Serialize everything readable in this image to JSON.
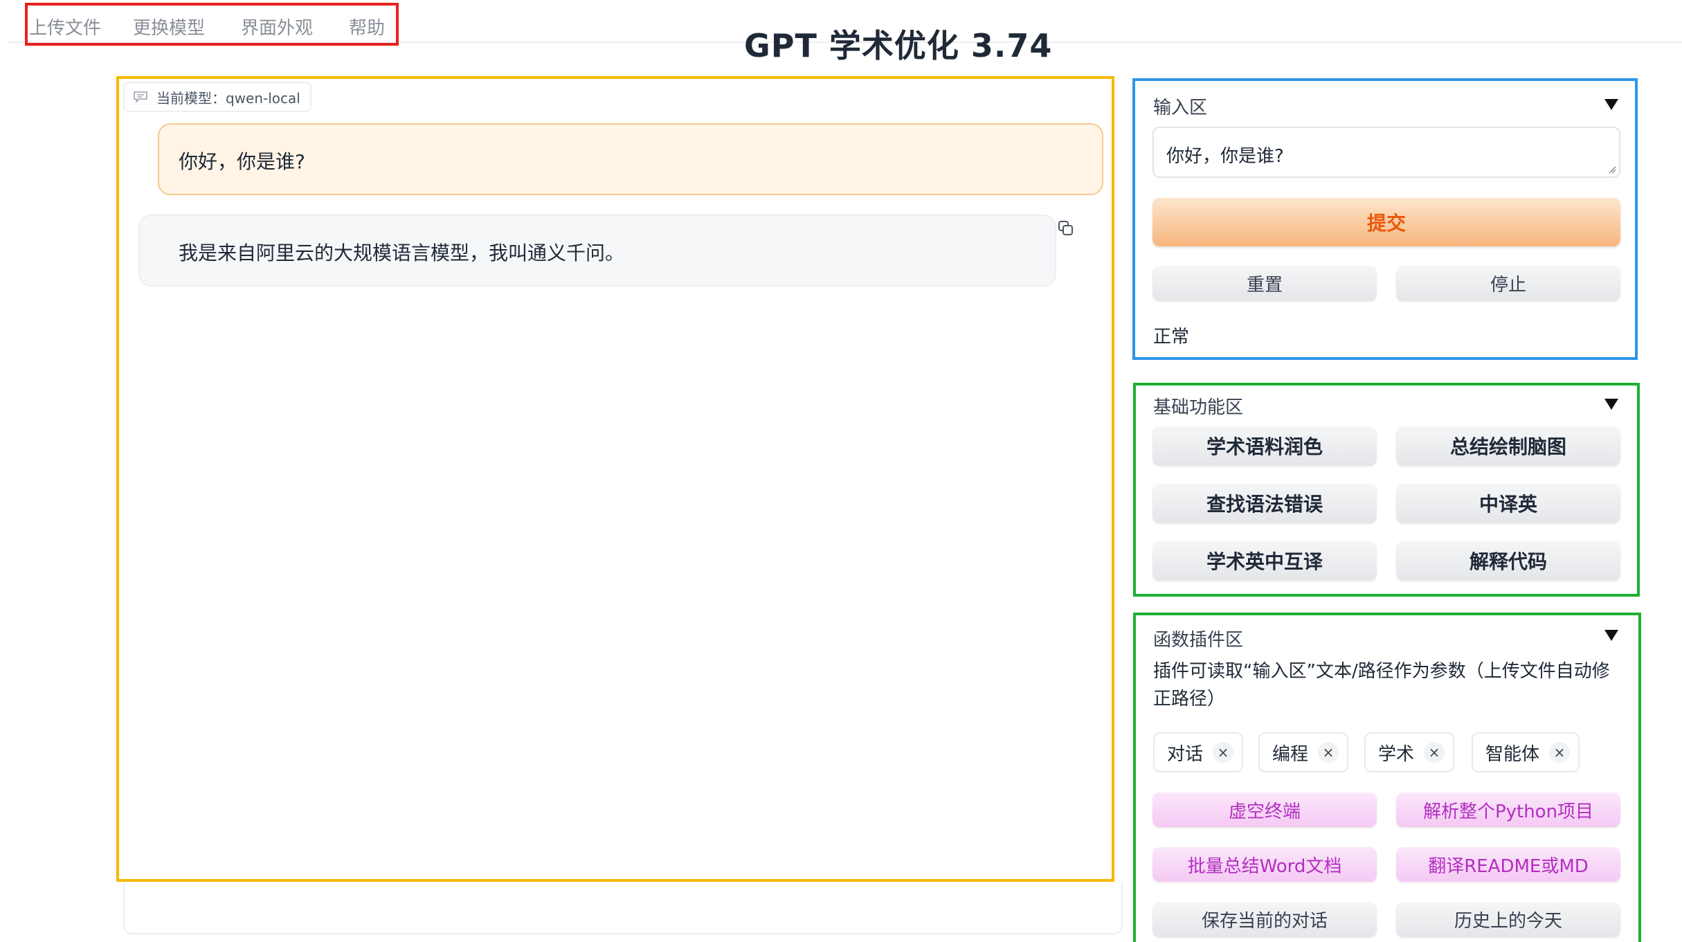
{
  "menu": {
    "upload": "上传文件",
    "switch_model": "更换模型",
    "appearance": "界面外观",
    "help": "帮助"
  },
  "title": "GPT 学术优化 3.74",
  "chat": {
    "model_badge": "当前模型：qwen-local",
    "messages": [
      {
        "role": "user",
        "text": "你好，你是谁?"
      },
      {
        "role": "assistant",
        "text": "我是来自阿里云的大规模语言模型，我叫通义千问。"
      }
    ]
  },
  "input_panel": {
    "label": "输入区",
    "value": "你好，你是谁?",
    "submit": "提交",
    "reset": "重置",
    "stop": "停止",
    "status": "正常"
  },
  "basic_panel": {
    "label": "基础功能区",
    "buttons": [
      "学术语料润色",
      "总结绘制脑图",
      "查找语法错误",
      "中译英",
      "学术英中互译",
      "解释代码"
    ]
  },
  "plugin_panel": {
    "label": "函数插件区",
    "description": "插件可读取“输入区”文本/路径作为参数（上传文件自动修正路径）",
    "tags": [
      "对话",
      "编程",
      "学术",
      "智能体"
    ],
    "buttons": [
      "虚空终端",
      "解析整个Python项目",
      "批量总结Word文档",
      "翻译README或MD",
      "保存当前的对话",
      "历史上的今天"
    ]
  },
  "colors": {
    "menu_highlight": "#e8211f",
    "chat_highlight": "#f5b800",
    "input_highlight": "#2b95e8",
    "function_highlight": "#1fb131",
    "submit_text": "#ea580c",
    "plugin_text": "#b32ec0"
  }
}
